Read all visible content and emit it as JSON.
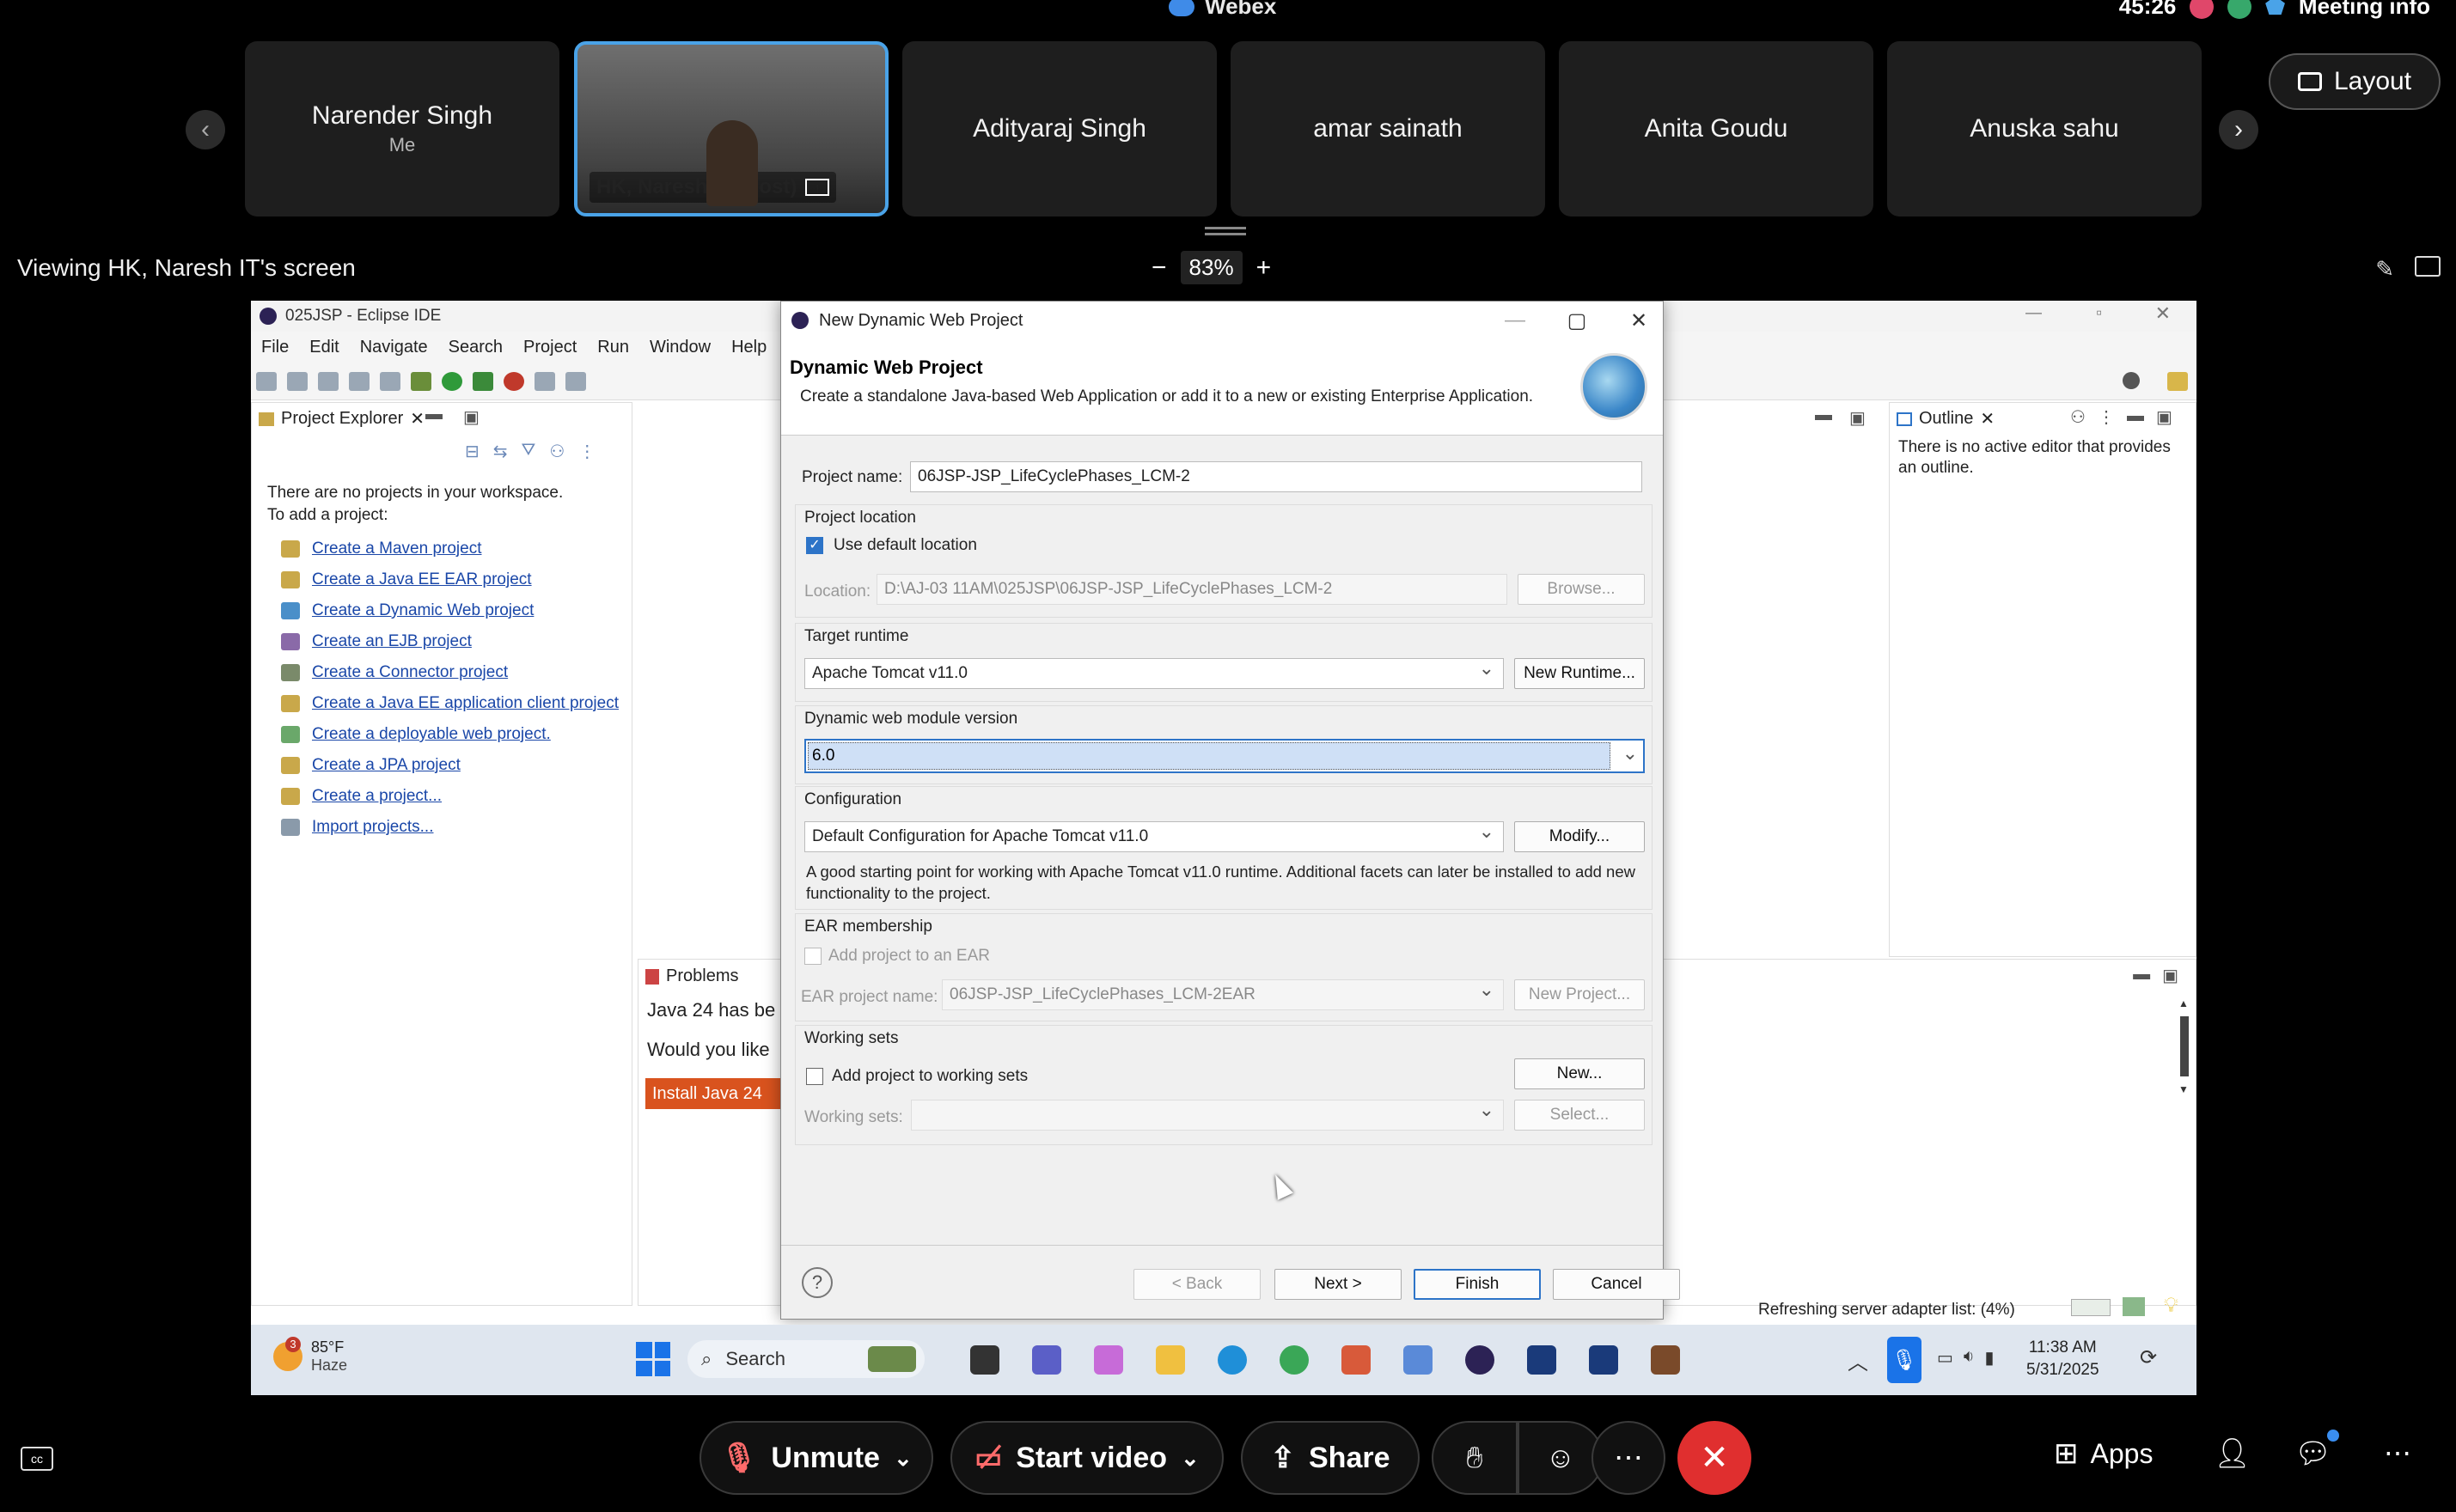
{
  "webex": {
    "app_name": "Webex",
    "timer": "45:26",
    "meeting_info": "Meeting info",
    "layout_label": "Layout",
    "viewing_text": "Viewing HK, Naresh IT's screen",
    "zoom": "83%",
    "zoom_minus": "−",
    "zoom_plus": "+",
    "participants": [
      {
        "name": "Narender Singh",
        "sub": "Me"
      },
      {
        "name": "HK, Naresh IT  (Host)",
        "sub": ""
      },
      {
        "name": "Adityaraj Singh",
        "sub": ""
      },
      {
        "name": "amar sainath",
        "sub": ""
      },
      {
        "name": "Anita Goudu",
        "sub": ""
      },
      {
        "name": "Anuska sahu",
        "sub": ""
      }
    ],
    "controls": {
      "unmute": "Unmute",
      "start_video": "Start video",
      "share": "Share",
      "apps": "Apps"
    }
  },
  "eclipse": {
    "title": "025JSP - Eclipse IDE",
    "menu": [
      "File",
      "Edit",
      "Navigate",
      "Search",
      "Project",
      "Run",
      "Window",
      "Help"
    ],
    "project_explorer": {
      "tab": "Project Explorer",
      "message_line1": "There are no projects in your workspace.",
      "message_line2": "To add a project:",
      "links": [
        "Create a Maven project",
        "Create a Java EE EAR project",
        "Create a Dynamic Web project",
        "Create an EJB project",
        "Create a Connector project",
        "Create a Java EE application client project",
        "Create a deployable web project.",
        "Create a JPA project",
        "Create a project...",
        "Import projects..."
      ]
    },
    "outline": {
      "tab": "Outline",
      "message": "There is no active editor that provides an outline."
    },
    "problems": {
      "tab": "Problems",
      "line1": "Java 24 has be",
      "line2": "Would you like",
      "button": "Install Java 24"
    },
    "status": "Refreshing server adapter list: (4%)"
  },
  "dialog": {
    "window_title": "New Dynamic Web Project",
    "heading": "Dynamic Web Project",
    "description": "Create a standalone Java-based Web Application or add it to a new or existing Enterprise Application.",
    "project_name_label": "Project name:",
    "project_name_value": "06JSP-JSP_LifeCyclePhases_LCM-2",
    "project_location_label": "Project location",
    "use_default_location": "Use default location",
    "location_label": "Location:",
    "location_value": "D:\\AJ-03 11AM\\025JSP\\06JSP-JSP_LifeCyclePhases_LCM-2",
    "browse": "Browse...",
    "target_runtime_label": "Target runtime",
    "target_runtime_value": "Apache Tomcat v11.0",
    "new_runtime": "New Runtime...",
    "module_version_label": "Dynamic web module version",
    "module_version_value": "6.0",
    "configuration_label": "Configuration",
    "configuration_value": "Default Configuration for Apache Tomcat v11.0",
    "modify": "Modify...",
    "configuration_desc": "A good starting point for working with Apache Tomcat v11.0 runtime. Additional facets can later be installed to add new functionality to the project.",
    "ear_label": "EAR membership",
    "ear_checkbox": "Add project to an EAR",
    "ear_name_label": "EAR project name:",
    "ear_name_value": "06JSP-JSP_LifeCyclePhases_LCM-2EAR",
    "new_project": "New Project...",
    "working_sets_label": "Working sets",
    "working_sets_checkbox": "Add project to working sets",
    "new_btn": "New...",
    "working_sets_field_label": "Working sets:",
    "select_btn": "Select...",
    "back": "< Back",
    "next": "Next >",
    "finish": "Finish",
    "cancel": "Cancel",
    "help": "?"
  },
  "taskbar": {
    "temp": "85°F",
    "weather": "Haze",
    "weather_badge": "3",
    "search": "Search",
    "time": "11:38 AM",
    "date": "5/31/2025"
  }
}
